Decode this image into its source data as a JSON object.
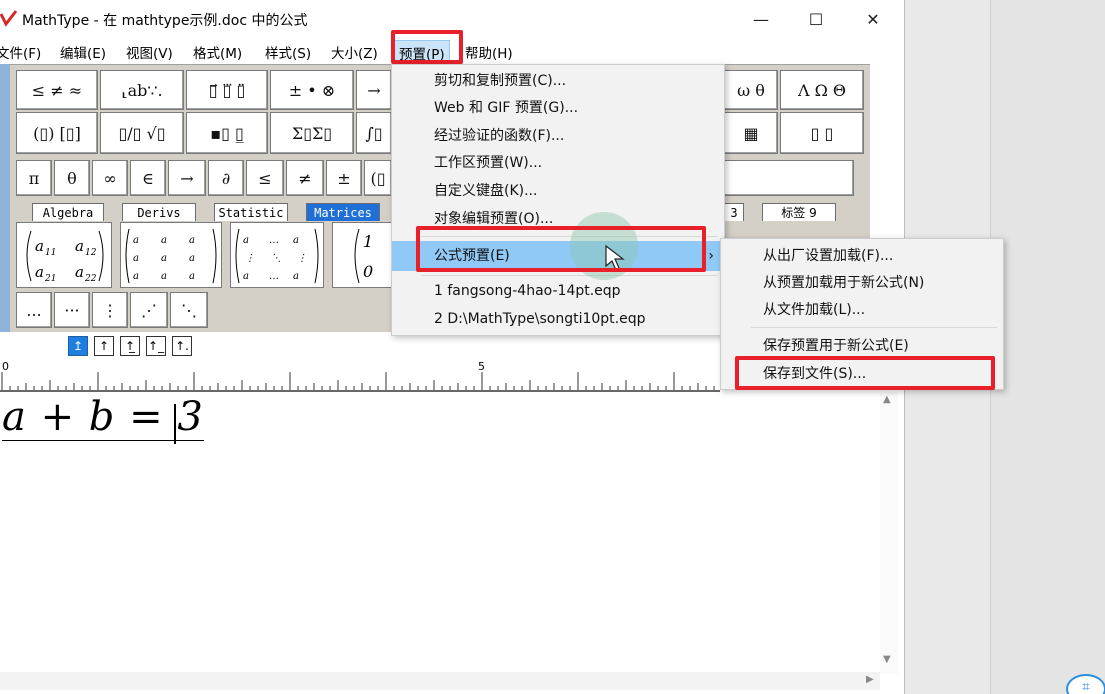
{
  "window": {
    "title": "MathType - 在 mathtype示例.doc 中的公式",
    "minimize_glyph": "—",
    "maximize_glyph": "☐",
    "close_glyph": "✕"
  },
  "menubar": [
    {
      "label": "文件(F)"
    },
    {
      "label": "编辑(E)"
    },
    {
      "label": "视图(V)"
    },
    {
      "label": "格式(M)"
    },
    {
      "label": "样式(S)"
    },
    {
      "label": "大小(Z)"
    },
    {
      "label": "预置(P)"
    },
    {
      "label": "帮助(H)"
    }
  ],
  "toolbar": {
    "row1": [
      "≤ ≠ ≈",
      "⸤ab∵.",
      "▯⃗ ▯⃛ ▯̈",
      "± • ⊗",
      "→",
      "ω θ",
      "Λ Ω Θ"
    ],
    "row2": [
      "(▯) [▯]",
      "▯/▯ √▯",
      "▪▯ ▯̲",
      "Σ▯Σ▯",
      "∫▯",
      "▦",
      "▯ ▯"
    ],
    "row3": [
      "π",
      "θ",
      "∞",
      "∈",
      "→",
      "∂",
      "≤",
      "≠",
      "±",
      "(▯"
    ],
    "tabs": [
      "Algebra",
      "Derivs",
      "Statistic",
      "Matrices",
      "3",
      "标签 9"
    ],
    "matrix_tiles": [
      "a11 a12 / a21 a22",
      "3×3 matrix",
      "m×n matrix",
      "1 / 0"
    ],
    "row5": [
      "...",
      "···",
      "⋮",
      "⋰",
      "⋱"
    ]
  },
  "align_buttons": [
    "↥",
    "↑",
    "↑̲",
    "↑_",
    "↑."
  ],
  "ruler": {
    "label_start": "0",
    "label_mid": "5"
  },
  "editor": {
    "equation": "a + b = 3"
  },
  "preset_menu": {
    "items": [
      "剪切和复制预置(C)...",
      "Web 和 GIF 预置(G)...",
      "经过验证的函数(F)...",
      "工作区预置(W)...",
      "自定义键盘(K)...",
      "对象编辑预置(O)...",
      "公式预置(E)",
      "1 fangsong-4hao-14pt.eqp",
      "2 D:\\MathType\\songti10pt.eqp"
    ],
    "submenu_arrow": "›"
  },
  "sub_menu": {
    "items": [
      "从出厂设置加载(F)...",
      "从预置加载用于新公式(N)",
      "从文件加载(L)...",
      "保存预置用于新公式(E)",
      "保存到文件(S)..."
    ]
  },
  "colors": {
    "highlight": "#90c8f6",
    "annotation_red": "#e8202a",
    "active_tab": "#1f6fd6"
  }
}
